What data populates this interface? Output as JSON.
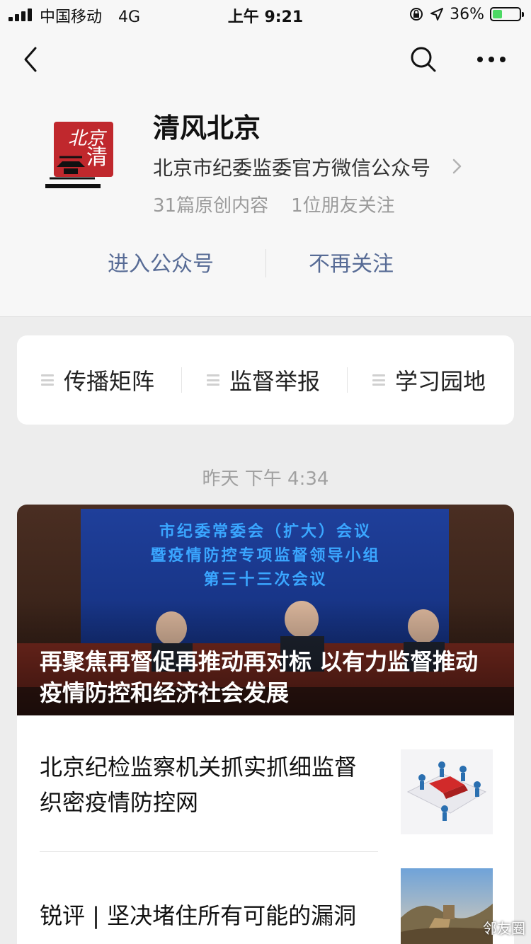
{
  "status_bar": {
    "carrier": "中国移动",
    "network": "4G",
    "time": "上午 9:21",
    "battery_percent": "36%",
    "battery_level": 0.36
  },
  "nav": {
    "back_icon": "chevron-left-icon",
    "search_icon": "search-icon",
    "more_icon": "more-dots-icon"
  },
  "account": {
    "name": "清风北京",
    "description": "北京市纪委监委官方微信公众号",
    "original_count": "31篇原创内容",
    "friends_following": "1位朋友关注",
    "logo_mark": "北京清风"
  },
  "actions": {
    "enter": "进入公众号",
    "unfollow": "不再关注"
  },
  "menu": [
    {
      "label": "传播矩阵"
    },
    {
      "label": "监督举报"
    },
    {
      "label": "学习园地"
    }
  ],
  "timestamp": "昨天 下午 4:34",
  "article": {
    "cover_banner": [
      "市纪委常委会（扩大）会议",
      "暨疫情防控专项监督领导小组",
      "第三十三次会议"
    ],
    "cover_title": "再聚焦再督促再推动再对标 以有力监督推动疫情防控和经济社会发展",
    "items": [
      {
        "title": "北京纪检监察机关抓实抓细监督 织密疫情防控网",
        "thumb": "puzzle-teamwork-image"
      },
      {
        "title": "锐评 | 坚决堵住所有可能的漏洞",
        "thumb": "great-wall-image"
      }
    ]
  },
  "watermark": "邻友圈",
  "colors": {
    "link_blue": "#576b95",
    "page_bg": "#ededed",
    "header_bg": "#f7f7f7",
    "battery_green": "#4cd964",
    "logo_red": "#c0282d"
  }
}
